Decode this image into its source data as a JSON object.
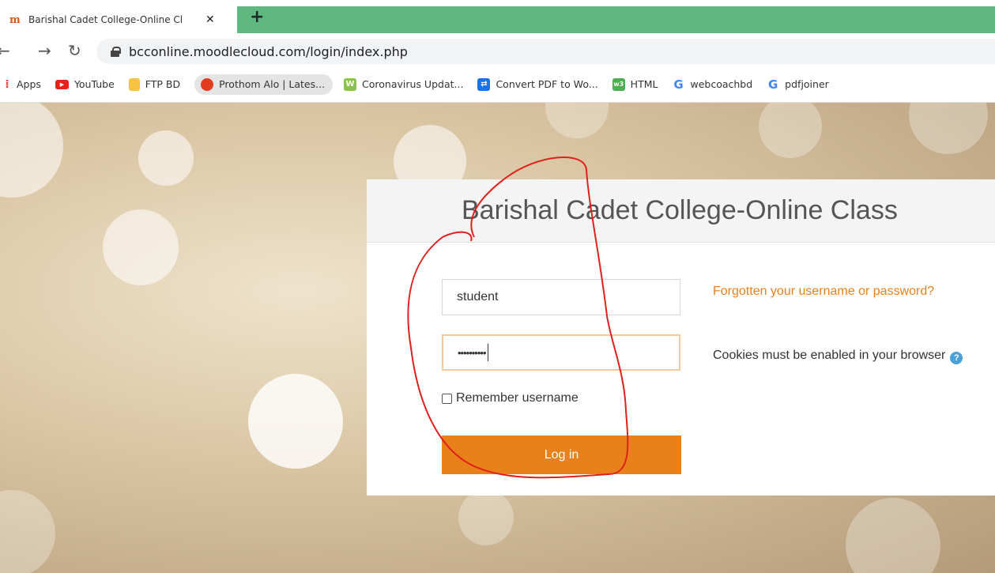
{
  "browser": {
    "tab_title": "Barishal Cadet College-Online Cl",
    "new_tab": "+",
    "url": "bcconline.moodlecloud.com/login/index.php",
    "bookmarks": [
      {
        "label": "Apps",
        "icon": "apps-grid-icon",
        "color": "#d93025"
      },
      {
        "label": "YouTube",
        "icon": "youtube-icon",
        "color": "#e62117"
      },
      {
        "label": "FTP BD",
        "icon": "folder-icon",
        "color": "#f6c342"
      },
      {
        "label": "Prothom Alo | Lates...",
        "icon": "prothom-alo-icon",
        "color": "#e33b1f"
      },
      {
        "label": "Coronavirus Updat...",
        "icon": "worldometer-icon",
        "color": "#8bc34a"
      },
      {
        "label": "Convert PDF to Wo...",
        "icon": "pdf-convert-icon",
        "color": "#1a73e8"
      },
      {
        "label": "HTML",
        "icon": "w3schools-icon",
        "color": "#4caf50"
      },
      {
        "label": "webcoachbd",
        "icon": "google-icon",
        "color": "#4285f4"
      },
      {
        "label": "pdfjoiner",
        "icon": "google-icon",
        "color": "#4285f4"
      }
    ]
  },
  "login": {
    "site_title": "Barishal Cadet College-Online Class",
    "username_value": "student",
    "password_value": "••••••••••",
    "remember_label": "Remember username",
    "login_button": "Log in",
    "forgot_link": "Forgotten your username or password?",
    "cookies_notice": "Cookies must be enabled in your browser"
  },
  "colors": {
    "accent": "#e8811a",
    "tab_strip": "#5fb880",
    "annotation": "#e0201c"
  }
}
